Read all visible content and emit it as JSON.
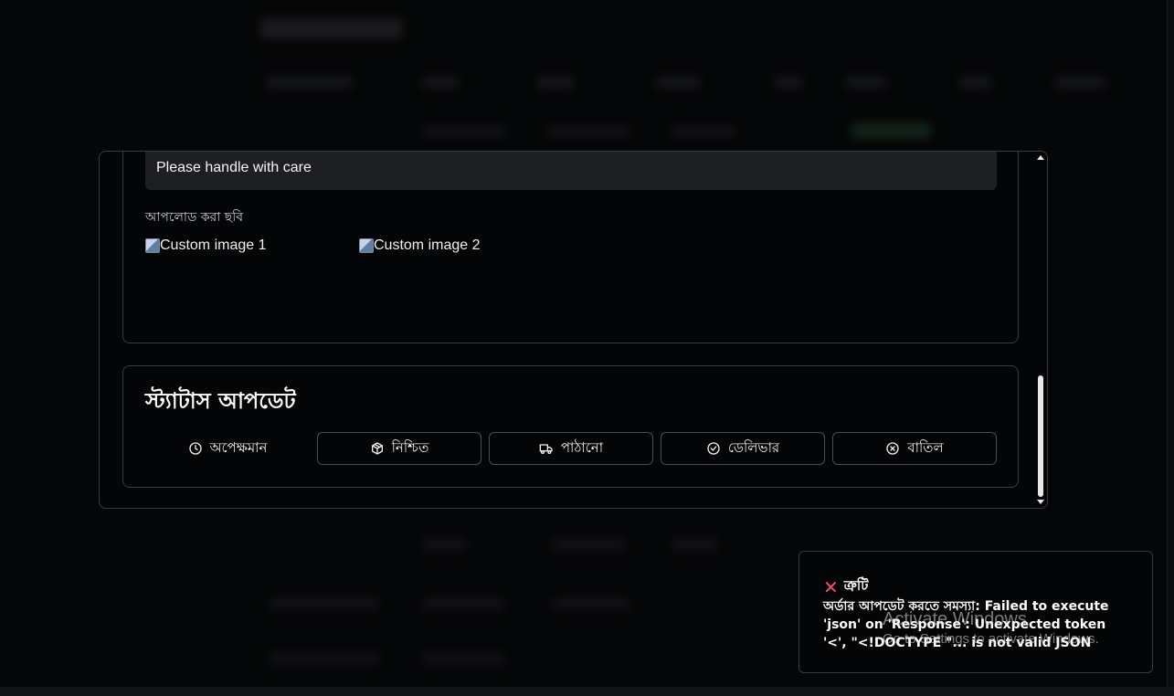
{
  "details": {
    "note": "Please handle with care",
    "uploaded_images_label": "আপলোড করা ছবি",
    "images": [
      {
        "alt": "Custom image 1"
      },
      {
        "alt": "Custom image 2"
      }
    ]
  },
  "status_update": {
    "title": "স্ট্যাটাস আপডেট",
    "buttons": [
      {
        "label": "অপেক্ষমান",
        "icon": "clock-icon",
        "active": true
      },
      {
        "label": "নিশ্চিত",
        "icon": "package-icon",
        "active": false
      },
      {
        "label": "পাঠানো",
        "icon": "truck-icon",
        "active": false
      },
      {
        "label": "ডেলিভার",
        "icon": "check-circle-icon",
        "active": false
      },
      {
        "label": "বাতিল",
        "icon": "x-circle-icon",
        "active": false
      }
    ]
  },
  "toast": {
    "title": "ত্রুটি",
    "icon": "close-x-icon",
    "icon_color": "#f0506e",
    "message": "অর্ডার আপডেট করতে সমস্যা: Failed to execute 'json' on 'Response': Unexpected token '<', \"<!DOCTYPE \"... is not valid JSON"
  },
  "watermark": {
    "line1": "Activate Windows",
    "line2": "Go to Settings to activate Windows."
  }
}
